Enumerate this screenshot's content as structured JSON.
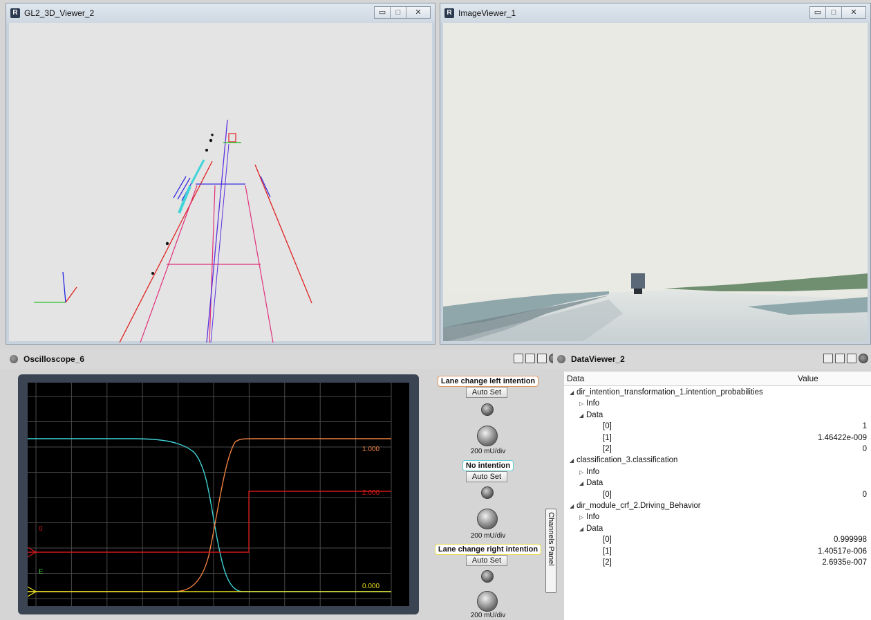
{
  "viewer3d": {
    "title": "GL2_3D_Viewer_2"
  },
  "imageviewer": {
    "title": "ImageViewer_1"
  },
  "oscilloscope": {
    "title": "Oscilloscope_6",
    "level_labels": [
      "1.000",
      "2.000",
      "0.000"
    ],
    "channel_marks": [
      "0",
      "E"
    ],
    "channels": [
      {
        "label": "Lane change left intention",
        "auto_set": "Auto Set",
        "scale": "200  mU/div",
        "border": "#e8935a"
      },
      {
        "label": "No intention",
        "auto_set": "Auto Set",
        "scale": "200  mU/div",
        "border": "#5fd0d8"
      },
      {
        "label": "Lane change right intention",
        "auto_set": "Auto Set",
        "scale": "200  mU/div",
        "border": "#e6d84a"
      }
    ],
    "channels_panel": "Channels Panel"
  },
  "dataviewer": {
    "title": "DataViewer_2",
    "col_data": "Data",
    "col_value": "Value",
    "rows": [
      {
        "label": "dir_intention_transformation_1.intention_probabilities",
        "value": "",
        "level": 0,
        "toggle": "open"
      },
      {
        "label": "Info",
        "value": "",
        "level": 1,
        "toggle": "closed"
      },
      {
        "label": "Data",
        "value": "",
        "level": 1,
        "toggle": "open"
      },
      {
        "label": "[0]",
        "value": "1",
        "level": 2,
        "toggle": "none"
      },
      {
        "label": "[1]",
        "value": "1.46422e-009",
        "level": 2,
        "toggle": "none"
      },
      {
        "label": "[2]",
        "value": "0",
        "level": 2,
        "toggle": "none"
      },
      {
        "label": "classification_3.classification",
        "value": "",
        "level": 0,
        "toggle": "open"
      },
      {
        "label": "Info",
        "value": "",
        "level": 1,
        "toggle": "closed"
      },
      {
        "label": "Data",
        "value": "",
        "level": 1,
        "toggle": "open"
      },
      {
        "label": "[0]",
        "value": "0",
        "level": 2,
        "toggle": "none"
      },
      {
        "label": "dir_module_crf_2.Driving_Behavior",
        "value": "",
        "level": 0,
        "toggle": "open"
      },
      {
        "label": "Info",
        "value": "",
        "level": 1,
        "toggle": "closed"
      },
      {
        "label": "Data",
        "value": "",
        "level": 1,
        "toggle": "open"
      },
      {
        "label": "[0]",
        "value": "0.999998",
        "level": 2,
        "toggle": "none"
      },
      {
        "label": "[1]",
        "value": "1.40517e-006",
        "level": 2,
        "toggle": "none"
      },
      {
        "label": "[2]",
        "value": "2.6935e-007",
        "level": 2,
        "toggle": "none"
      }
    ]
  },
  "colors": {
    "lane_red": "#e02020",
    "lane_pink": "#e0307a",
    "lane_blue": "#3a2ee0",
    "trace_cyan": "#3fd4d8",
    "trace_orange": "#f08040",
    "trace_red": "#d01818",
    "trace_yellow": "#e8e020"
  }
}
